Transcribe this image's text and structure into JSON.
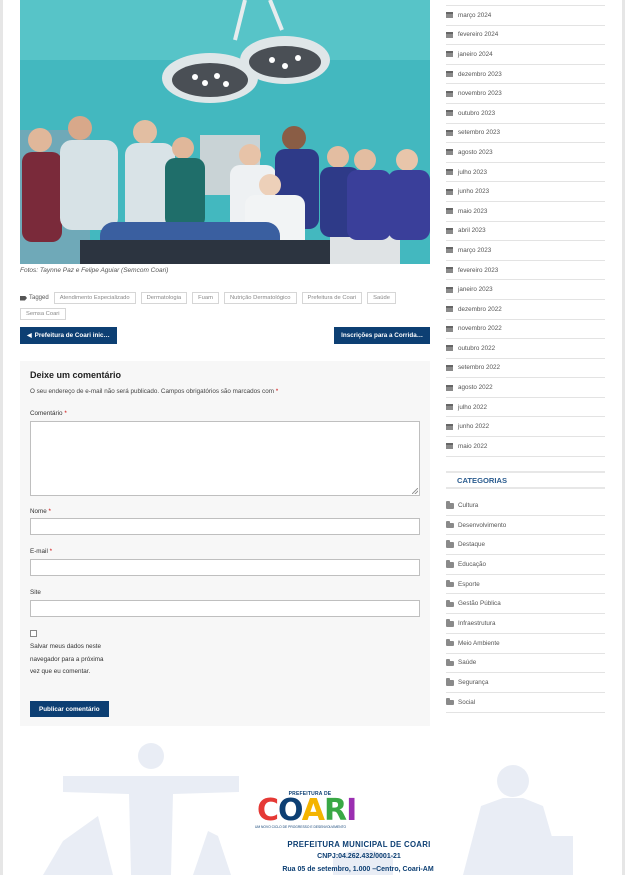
{
  "article": {
    "photo_caption": "Fotos: Taynne Paz e Felipe Aguiar (Semcom Coari)",
    "tagged_label": "Tagged",
    "tags": [
      "Atendimento Especializado",
      "Dermatologia",
      "Fuam",
      "Nutrição Dermatológico",
      "Prefeitura de Coari",
      "Saúde",
      "Semsa Coari"
    ]
  },
  "post_nav": {
    "prev_label": "Prefeitura de Coari inic…",
    "next_label": "Inscrições para a Corrida…"
  },
  "comment_form": {
    "title": "Deixe um comentário",
    "notes": "O seu endereço de e-mail não será publicado. Campos obrigatórios são marcados com",
    "required_mark": "*",
    "comment_label": "Comentário",
    "name_label": "Nome",
    "email_label": "E-mail",
    "site_label": "Site",
    "save_info_label": "Salvar meus dados neste navegador para a próxima vez que eu comentar.",
    "submit_label": "Publicar comentário"
  },
  "sidebar": {
    "archives": [
      "março 2024",
      "fevereiro 2024",
      "janeiro 2024",
      "dezembro 2023",
      "novembro 2023",
      "outubro 2023",
      "setembro 2023",
      "agosto 2023",
      "julho 2023",
      "junho 2023",
      "maio 2023",
      "abril 2023",
      "março 2023",
      "fevereiro 2023",
      "janeiro 2023",
      "dezembro 2022",
      "novembro 2022",
      "outubro 2022",
      "setembro 2022",
      "agosto 2022",
      "julho 2022",
      "junho 2022",
      "maio 2022"
    ],
    "categories_title": "CATEGORIAS",
    "categories": [
      "Cultura",
      "Desenvolvimento",
      "Destaque",
      "Educação",
      "Esporte",
      "Gestão Pública",
      "Infraestrutura",
      "Meio Ambiente",
      "Saúde",
      "Segurança",
      "Social"
    ]
  },
  "footer": {
    "logo_prefix": "PREFEITURA DE",
    "logo_text": "COARI",
    "logo_slogan": "UM NOVO CICLO DE PROGRESSO E DESENVOLVIMENTO",
    "org_name": "PREFEITURA MUNICIPAL DE COARI",
    "cnpj": "CNPJ:04.262.432/0001-21",
    "address": "Rua 05 de setembro, 1.000 –Centro, Coari-AM"
  },
  "colors": {
    "primary": "#0d3f73",
    "category_title": "#2b5c8f",
    "photo_wall": "#3fb7bd"
  }
}
